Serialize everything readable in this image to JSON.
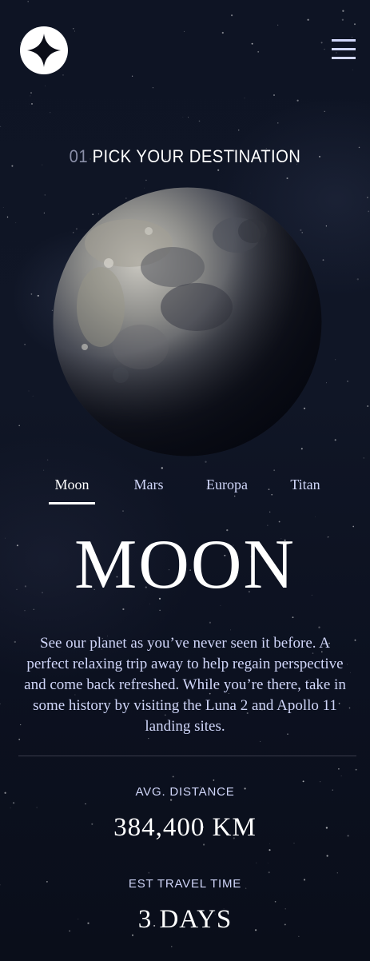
{
  "header": {
    "logo_icon": "star-logo-icon",
    "menu_icon": "hamburger-menu-icon"
  },
  "page": {
    "step_number": "01",
    "heading": "PICK YOUR DESTINATION"
  },
  "tabs": [
    {
      "label": "Moon",
      "active": true
    },
    {
      "label": "Mars",
      "active": false
    },
    {
      "label": "Europa",
      "active": false
    },
    {
      "label": "Titan",
      "active": false
    }
  ],
  "destination": {
    "name": "MOON",
    "description": "See our planet as you’ve never seen it before. A perfect relaxing trip away to help regain perspective and come back refreshed. While you’re there, take in some history by visiting the Luna 2 and Apollo 11 landing sites.",
    "distance_label": "AVG. DISTANCE",
    "distance_value": "384,400 KM",
    "travel_label": "EST TRAVEL TIME",
    "travel_value": "3 DAYS"
  },
  "colors": {
    "background": "#0b0d17",
    "accent_light": "#d0d6f9",
    "white": "#ffffff",
    "divider": "#383b4b"
  }
}
